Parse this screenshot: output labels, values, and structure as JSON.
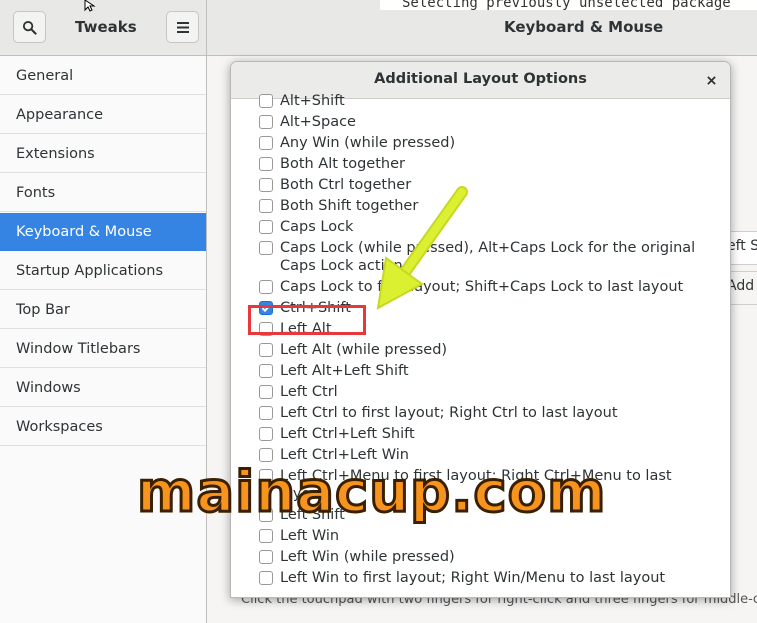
{
  "window": {
    "app_title": "Tweaks",
    "section_title": "Keyboard & Mouse",
    "terminal_text": "Selecting previously unselected package"
  },
  "toolbar": {
    "search_icon": "search-icon",
    "menu_icon": "hamburger-menu-icon"
  },
  "sidebar": {
    "items": [
      {
        "label": "General"
      },
      {
        "label": "Appearance"
      },
      {
        "label": "Extensions"
      },
      {
        "label": "Fonts"
      },
      {
        "label": "Keyboard & Mouse",
        "active": true
      },
      {
        "label": "Startup Applications"
      },
      {
        "label": "Top Bar"
      },
      {
        "label": "Window Titlebars"
      },
      {
        "label": "Windows"
      },
      {
        "label": "Workspaces"
      }
    ]
  },
  "background": {
    "fragment_1": "eft S",
    "fragment_2": "Add",
    "bottom_text": "Click the touchpad with two fingers for right-click and three fingers for middle-click."
  },
  "dialog": {
    "title": "Additional Layout Options",
    "close_icon": "close-icon",
    "options": [
      {
        "label": "Alt+Shift",
        "checked": false
      },
      {
        "label": "Alt+Space",
        "checked": false
      },
      {
        "label": "Any Win (while pressed)",
        "checked": false
      },
      {
        "label": "Both Alt together",
        "checked": false
      },
      {
        "label": "Both Ctrl together",
        "checked": false
      },
      {
        "label": "Both Shift together",
        "checked": false
      },
      {
        "label": "Caps Lock",
        "checked": false
      },
      {
        "label": "Caps Lock (while pressed), Alt+Caps Lock for the original Caps Lock action",
        "checked": false
      },
      {
        "label": "Caps Lock to first layout; Shift+Caps Lock to last layout",
        "checked": false
      },
      {
        "label": "Ctrl+Shift",
        "checked": true
      },
      {
        "label": "Left Alt",
        "checked": false
      },
      {
        "label": "Left Alt (while pressed)",
        "checked": false
      },
      {
        "label": "Left Alt+Left Shift",
        "checked": false
      },
      {
        "label": "Left Ctrl",
        "checked": false
      },
      {
        "label": "Left Ctrl to first layout; Right Ctrl to last layout",
        "checked": false
      },
      {
        "label": "Left Ctrl+Left Shift",
        "checked": false
      },
      {
        "label": "Left Ctrl+Left Win",
        "checked": false
      },
      {
        "label": "Left Ctrl+Menu to first layout; Right Ctrl+Menu to last layout",
        "checked": false
      },
      {
        "label": "Left Shift",
        "checked": false
      },
      {
        "label": "Left Win",
        "checked": false
      },
      {
        "label": "Left Win (while pressed)",
        "checked": false
      },
      {
        "label": "Left Win to first layout; Right Win/Menu to last layout",
        "checked": false
      }
    ]
  },
  "annotation": {
    "watermark": "mainacup.com",
    "arrow_color": "#d9f02a",
    "highlight_color": "#e8383b"
  },
  "colors": {
    "accent": "#3584e4"
  }
}
